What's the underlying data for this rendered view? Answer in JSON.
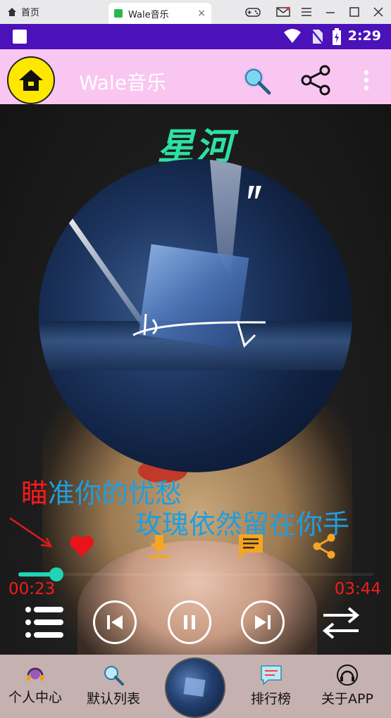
{
  "emulator": {
    "home_label": "首页",
    "tab_label": "Wale音乐",
    "tab_close": "×"
  },
  "status_bar": {
    "time": "2:29"
  },
  "toolbar": {
    "title": "Wale音乐"
  },
  "player": {
    "song_title": "星河",
    "lyric_line1_highlight": "瞄",
    "lyric_line1_rest": "准你的忧愁",
    "lyric_line2": "玫瑰依然留在你手",
    "current_time": "00:23",
    "total_time": "03:44",
    "progress": 0.1
  },
  "bottom_nav": {
    "items": [
      {
        "label": "个人中心",
        "icon": "headphone-avatar-icon"
      },
      {
        "label": "默认列表",
        "icon": "search-icon"
      },
      {
        "label": "排行榜",
        "icon": "chat-icon"
      },
      {
        "label": "关于APP",
        "icon": "headphones-icon"
      }
    ]
  },
  "colors": {
    "status_bar": "#4a12b8",
    "toolbar": "#f9c6f1",
    "title": "#2de0a4",
    "lyric": "#1e9ee0",
    "highlight": "#f21b1b",
    "seek": "#22d3b7",
    "action_orange": "#f5a623",
    "bottom_nav": "#c6b1b1"
  }
}
